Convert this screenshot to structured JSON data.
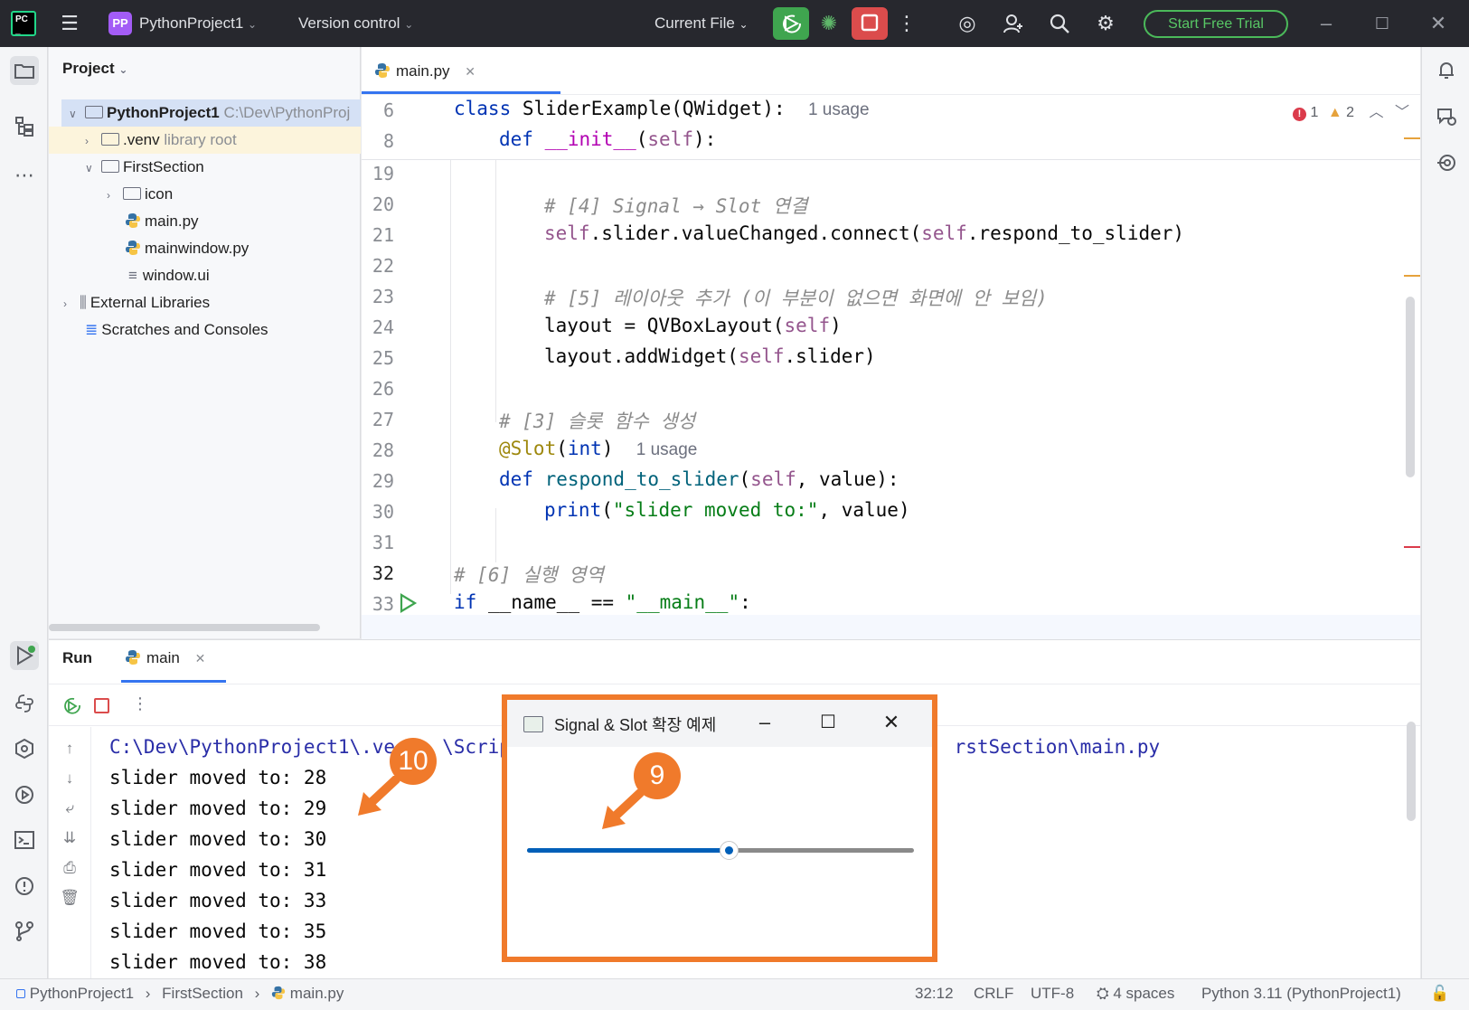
{
  "titlebar": {
    "project_badge": "PP",
    "project_name": "PythonProject1",
    "vcs": "Version control",
    "run_config": "Current File",
    "trial": "Start Free Trial"
  },
  "project_panel": {
    "header": "Project",
    "rows": [
      {
        "label": "PythonProject1",
        "extra": "C:\\Dev\\PythonProj"
      },
      {
        "label": ".venv",
        "extra": "library root"
      },
      {
        "label": "FirstSection",
        "extra": ""
      },
      {
        "label": "icon",
        "extra": ""
      },
      {
        "label": "main.py",
        "extra": ""
      },
      {
        "label": "mainwindow.py",
        "extra": ""
      },
      {
        "label": "window.ui",
        "extra": ""
      },
      {
        "label": "External Libraries",
        "extra": ""
      },
      {
        "label": "Scratches and Consoles",
        "extra": ""
      }
    ]
  },
  "editor": {
    "tab": "main.py",
    "inspection": {
      "errors": "1",
      "warnings": "2"
    },
    "lines": [
      {
        "n": "6",
        "code": "class SliderExample(QWidget):",
        "hint": "1 usage"
      },
      {
        "n": "8",
        "code": "def __init__(self):",
        "hint": ""
      },
      {
        "n": "19",
        "code": "",
        "hint": ""
      },
      {
        "n": "20",
        "code": "# [4] Signal → Slot 연결",
        "hint": ""
      },
      {
        "n": "21",
        "code": "self.slider.valueChanged.connect(self.respond_to_slider)",
        "hint": ""
      },
      {
        "n": "22",
        "code": "",
        "hint": ""
      },
      {
        "n": "23",
        "code": "# [5] 레이아웃 추가 (이 부분이 없으면 화면에 안 보임)",
        "hint": ""
      },
      {
        "n": "24",
        "code": "layout = QVBoxLayout(self)",
        "hint": ""
      },
      {
        "n": "25",
        "code": "layout.addWidget(self.slider)",
        "hint": ""
      },
      {
        "n": "26",
        "code": "",
        "hint": ""
      },
      {
        "n": "27",
        "code": "# [3] 슬롯 함수 생성",
        "hint": ""
      },
      {
        "n": "28",
        "code": "@Slot(int)",
        "hint": "1 usage"
      },
      {
        "n": "29",
        "code": "def respond_to_slider(self, value):",
        "hint": ""
      },
      {
        "n": "30",
        "code": "print(\"slider moved to:\", value)",
        "hint": ""
      },
      {
        "n": "31",
        "code": "",
        "hint": ""
      },
      {
        "n": "32",
        "code": "# [6] 실행 영역",
        "hint": ""
      },
      {
        "n": "33",
        "code": "if __name__ == \"__main__\":",
        "hint": ""
      }
    ]
  },
  "run_panel": {
    "title": "Run",
    "tab": "main",
    "console": [
      "C:\\Dev\\PythonProject1\\.ve",
      "\\Script",
      "rstSection\\main.py",
      "slider moved to: 28",
      "slider moved to: 29",
      "slider moved to: 30",
      "slider moved to: 31",
      "slider moved to: 33",
      "slider moved to: 35",
      "slider moved to: 38"
    ]
  },
  "dialog": {
    "title": "Signal & Slot 확장 예제",
    "slider_value_fraction": 0.52
  },
  "callouts": {
    "a": "10",
    "b": "9"
  },
  "statusbar": {
    "breadcrumb": [
      "PythonProject1",
      "FirstSection",
      "main.py"
    ],
    "position": "32:12",
    "line_sep": "CRLF",
    "encoding": "UTF-8",
    "indent": "4 spaces",
    "interpreter": "Python 3.11 (PythonProject1)"
  },
  "colors": {
    "accent": "#3574f0",
    "callout": "#f07a2b",
    "run_green": "#3fa54f",
    "stop_red": "#db4c4c"
  }
}
